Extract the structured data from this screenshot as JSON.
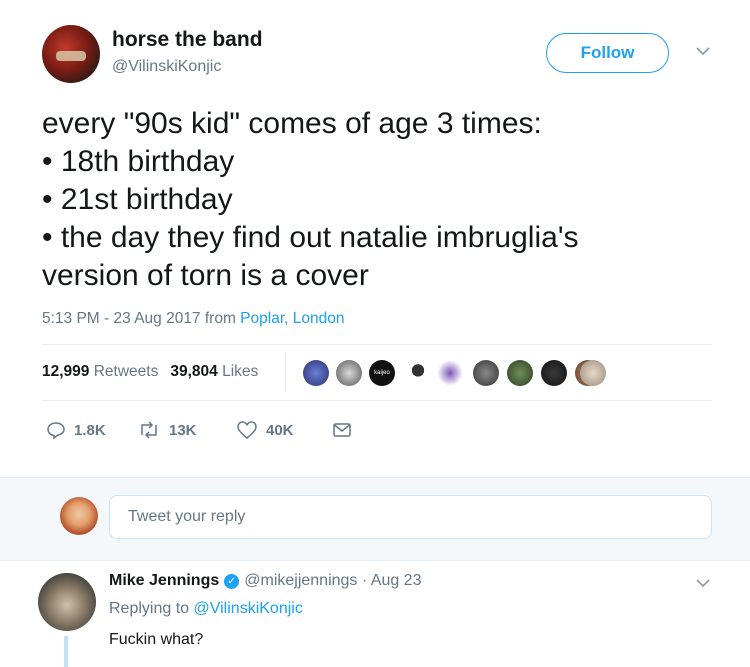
{
  "author": {
    "display_name": "horse the band",
    "handle": "@VilinskiKonjic"
  },
  "follow_label": "Follow",
  "tweet": {
    "lines": [
      "every \"90s kid\" comes of age 3 times:",
      "• 18th birthday",
      "• 21st birthday",
      "• the day they find out natalie imbruglia's",
      "version of torn is a cover"
    ],
    "timestamp": "5:13 PM - 23 Aug 2017 from ",
    "location": "Poplar, London"
  },
  "stats": {
    "retweets_count": "12,999",
    "retweets_label": "Retweets",
    "likes_count": "39,804",
    "likes_label": "Likes",
    "liker_badge": "kaijeo"
  },
  "actions": {
    "reply_count": "1.8K",
    "retweet_count": "13K",
    "like_count": "40K"
  },
  "reply_box": {
    "placeholder": "Tweet your reply"
  },
  "reply": {
    "name": "Mike Jennings",
    "meta": "@mikejjennings · Aug 23",
    "replying_prefix": "Replying to ",
    "replying_to": "@VilinskiKonjic",
    "text": "Fuckin what?"
  },
  "colors": {
    "accent": "#1da1f2",
    "muted": "#657786"
  }
}
